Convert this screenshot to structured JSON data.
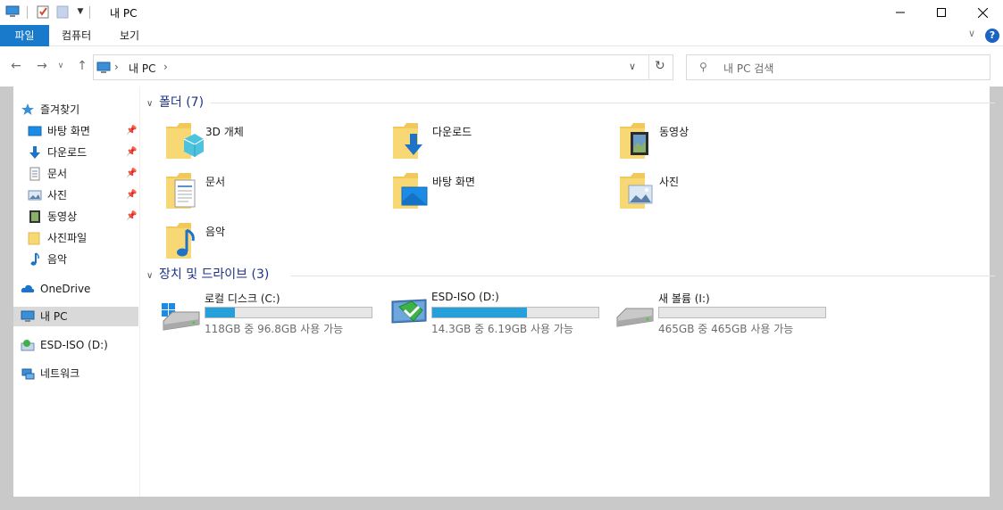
{
  "window": {
    "title": "내 PC"
  },
  "ribbon": {
    "tabs": [
      "파일",
      "컴퓨터",
      "보기"
    ]
  },
  "address": {
    "crumb": "내 PC",
    "search_placeholder": "내 PC 검색"
  },
  "nav": {
    "quick_access": "즐겨찾기",
    "items": [
      {
        "label": "바탕 화면",
        "icon": "desktop-icon",
        "pinned": true
      },
      {
        "label": "다운로드",
        "icon": "download-icon",
        "pinned": true
      },
      {
        "label": "문서",
        "icon": "document-icon",
        "pinned": true
      },
      {
        "label": "사진",
        "icon": "picture-icon",
        "pinned": true
      },
      {
        "label": "동영상",
        "icon": "video-icon",
        "pinned": true
      },
      {
        "label": "사진파일",
        "icon": "folder-icon",
        "pinned": false
      },
      {
        "label": "음악",
        "icon": "music-icon",
        "pinned": false
      }
    ],
    "onedrive": "OneDrive",
    "thispc": "내 PC",
    "esd": "ESD-ISO (D:)",
    "network": "네트워크"
  },
  "folders": {
    "header": "폴더 (7)",
    "items": [
      "3D 개체",
      "다운로드",
      "동영상",
      "문서",
      "바탕 화면",
      "사진",
      "음악"
    ]
  },
  "drives": {
    "header": "장치 및 드라이브 (3)",
    "items": [
      {
        "name": "로컬 디스크 (C:)",
        "size_text": "118GB 중 96.8GB 사용 가능",
        "used_fraction": 0.18
      },
      {
        "name": "ESD-ISO (D:)",
        "size_text": "14.3GB 중 6.19GB 사용 가능",
        "used_fraction": 0.57
      },
      {
        "name": "새 볼륨 (I:)",
        "size_text": "465GB 중 465GB 사용 가능",
        "used_fraction": 0.0
      }
    ]
  },
  "colors": {
    "accent": "#1979ca",
    "bar_fill": "#26a0da",
    "group_header": "#1e3287"
  }
}
